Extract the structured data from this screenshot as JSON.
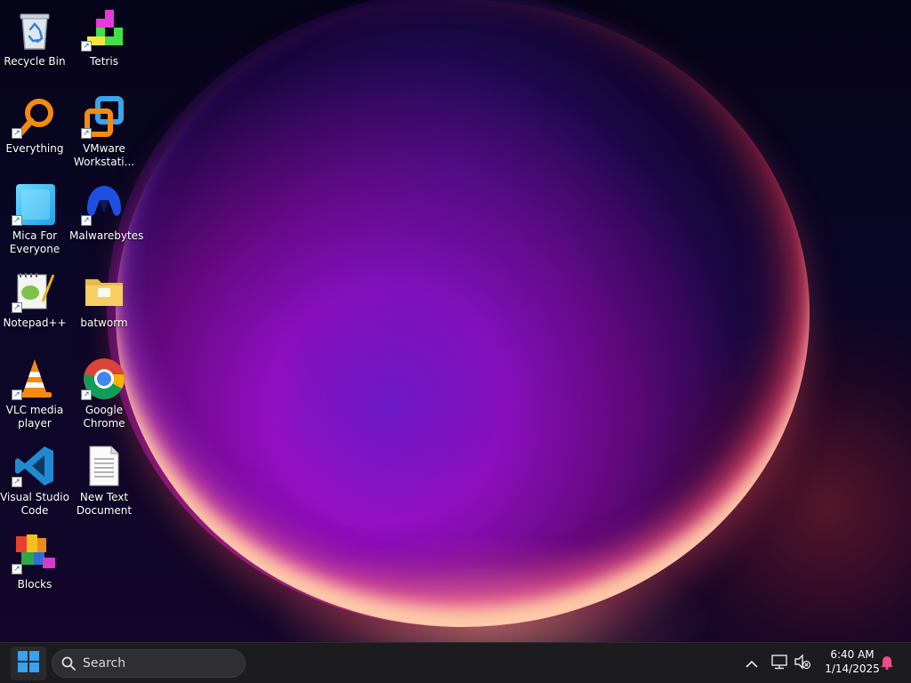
{
  "desktop": {
    "icons": [
      {
        "label": "Recycle Bin",
        "icon": "recycle-bin-icon",
        "shortcut": false
      },
      {
        "label": "Tetris",
        "icon": "tetris-icon",
        "shortcut": true
      },
      {
        "label": "Everything",
        "icon": "everything-search-icon",
        "shortcut": true
      },
      {
        "label": "VMware Workstati...",
        "icon": "vmware-icon",
        "shortcut": true
      },
      {
        "label": "Mica For Everyone",
        "icon": "mica-icon",
        "shortcut": true
      },
      {
        "label": "Malwarebytes",
        "icon": "malwarebytes-icon",
        "shortcut": true
      },
      {
        "label": "Notepad++",
        "icon": "notepad-plus-plus-icon",
        "shortcut": true
      },
      {
        "label": "batworm",
        "icon": "folder-icon",
        "shortcut": false
      },
      {
        "label": "VLC media player",
        "icon": "vlc-icon",
        "shortcut": true
      },
      {
        "label": "Google Chrome",
        "icon": "chrome-icon",
        "shortcut": true
      },
      {
        "label": "Visual Studio Code",
        "icon": "vscode-icon",
        "shortcut": true
      },
      {
        "label": "New Text Document",
        "icon": "text-document-icon",
        "shortcut": false
      },
      {
        "label": "Blocks",
        "icon": "blocks-icon",
        "shortcut": true
      }
    ]
  },
  "taskbar": {
    "search_placeholder": "Search",
    "clock_time": "6:40 AM",
    "clock_date": "1/14/2025"
  },
  "colors": {
    "taskbar_bg": "#1c1c1f",
    "windows_blue": "#3aa0f0",
    "wallpaper_accent": "#9a10c8"
  }
}
